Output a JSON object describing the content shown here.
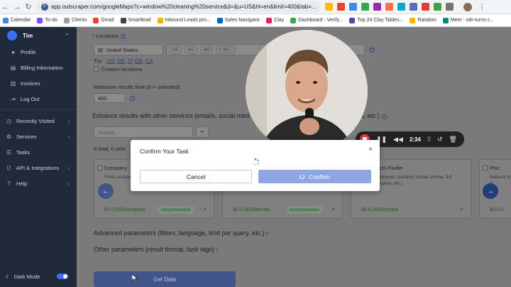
{
  "browser": {
    "url": "app.outscraper.com/googleMaps?c=window%20cleaning%20service&d=&u=US&hl=en&limit=400&tab=...",
    "site_initials": "F"
  },
  "bookmarks": [
    {
      "label": "Calendar",
      "color": "#4285f4"
    },
    {
      "label": "To-do",
      "color": "#7c4dff"
    },
    {
      "label": "Clients",
      "color": "#9e9e9e"
    },
    {
      "label": "Gmail",
      "color": "#ea4335"
    },
    {
      "label": "Smartlead",
      "color": "#424242"
    },
    {
      "label": "Inbound Leads pro...",
      "color": "#f4b400"
    },
    {
      "label": "Sales Navigator",
      "color": "#0a66c2"
    },
    {
      "label": "Clay",
      "color": "#e91e63"
    },
    {
      "label": "Dashboard - Verify...",
      "color": "#34a853"
    },
    {
      "label": "Top 24 Clay Tables...",
      "color": "#673ab7"
    },
    {
      "label": "Random",
      "color": "#ffb300"
    },
    {
      "label": "Meet - odr-turnn-r...",
      "color": "#00897b"
    }
  ],
  "sidebar": {
    "user": "Tim",
    "account_items": [
      "Profile",
      "Billing Information",
      "Invoices",
      "Log Out"
    ],
    "nav_items": [
      "Recently Visited",
      "Services",
      "Tasks",
      "API & Integrations",
      "Help"
    ],
    "dark_mode": "Dark Mode"
  },
  "main": {
    "locations_label": "Locations",
    "country": "United States",
    "state_chips": [
      "AK",
      "AL",
      "AR",
      "+ 49..."
    ],
    "try_label": "Try:",
    "try_codes": [
      "US",
      "DE",
      "IT",
      "GB",
      "CA"
    ],
    "custom_locations": "Custom locations",
    "limit_label": "Maximum results limit (0 = unlimited)",
    "limit_value": "400",
    "enhance_label": "Enhance results with other services (emails, social med",
    "enhance_tail": "s, etc.)",
    "search_placeholder": "Search",
    "total_text": "8 total, 0 sele",
    "cards": [
      {
        "title": "Company",
        "desc": "Finds compan founding year",
        "price": "$0-0.005/company",
        "badge": "recommended"
      },
      {
        "title": "",
        "desc": "",
        "price": "$0-0.003/domain",
        "badge": "recommended"
      },
      {
        "title": "cts Finder",
        "desc": "ployees contacts (email, phone, full name, etc.)",
        "price": "$0-0.003/contact",
        "badge": ""
      },
      {
        "title": "Pho",
        "desc": "Returns line ty",
        "price": "$0-0.0",
        "badge": ""
      }
    ],
    "advanced": "Advanced parameters (filters, language, limit per query, etc.)",
    "other": "Other parameters (result format, task tags)",
    "get_data": "Get Data"
  },
  "recorder": {
    "time": "2:34"
  },
  "modal": {
    "title": "Confirm Your Task",
    "cancel": "Cancel",
    "confirm": "Confirm"
  }
}
